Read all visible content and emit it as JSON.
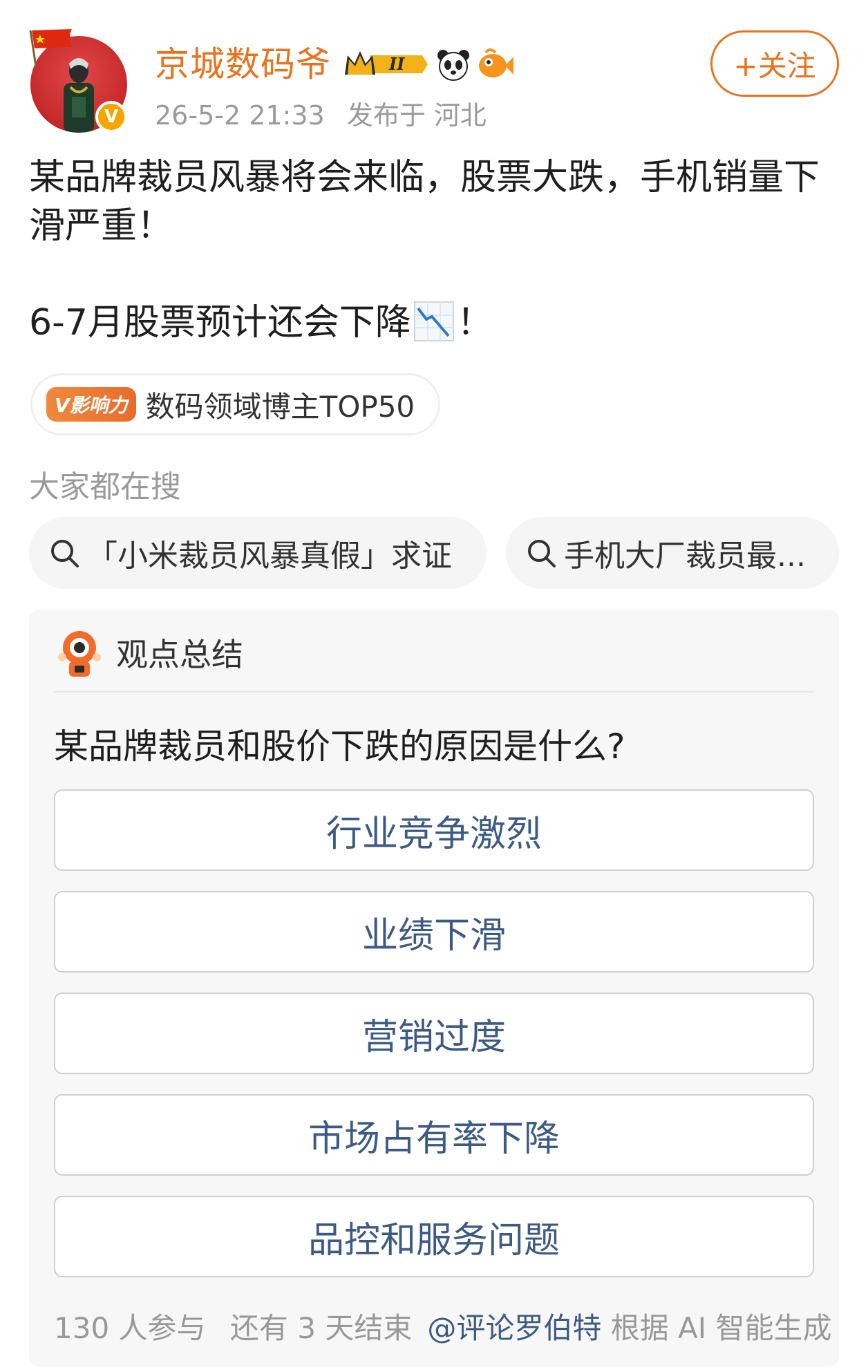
{
  "post": {
    "author": {
      "name": "京城数码爷",
      "timestamp": "26-5-2 21:33",
      "location": "发布于 河北",
      "crown_badge_text": "II"
    },
    "follow_label": "+关注",
    "text_line1": "某品牌裁员风暴将会来临，股票大跌，手机销量下滑严重！",
    "text_line2_before": "6-7月股票预计还会下降",
    "text_line2_after": "！",
    "influence": {
      "badge": "V影响力",
      "label": "数码领域博主TOP50"
    }
  },
  "searches": {
    "title": "大家都在搜",
    "items": [
      "「小米裁员风暴真假」求证",
      "手机大厂裁员最..."
    ]
  },
  "summary": {
    "title": "观点总结",
    "question": "某品牌裁员和股价下跌的原因是什么?",
    "options": [
      "行业竞争激烈",
      "业绩下滑",
      "营销过度",
      "市场占有率下降",
      "品控和服务问题"
    ],
    "participants": "130 人参与",
    "remaining": "还有 3 天结束",
    "credit_mention": "@评论罗伯特",
    "credit_rest": " 根据 AI 智能生成"
  },
  "colors": {
    "accent": "#e8731c",
    "option_text": "#3c5a86",
    "muted": "#9a9a9a"
  },
  "icons": [
    "china-flag-icon",
    "verified-badge-icon",
    "crown-level-icon",
    "panda-icon",
    "fish-icon",
    "chart-down-icon",
    "search-icon",
    "robot-icon"
  ]
}
